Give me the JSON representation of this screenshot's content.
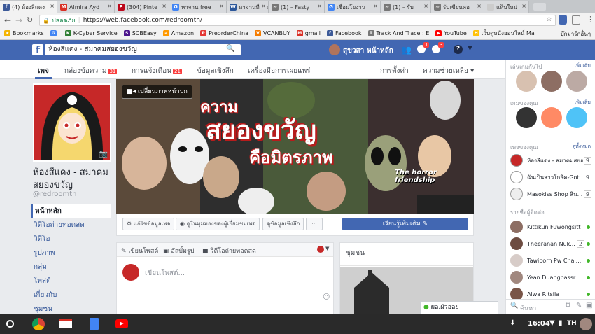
{
  "browser": {
    "tabs": [
      {
        "label": "(4) ห้องสีแดง",
        "icon": "f",
        "color": "#3b5998",
        "active": true
      },
      {
        "label": "Almira Ayd",
        "icon": "M",
        "color": "#d93025"
      },
      {
        "label": "(304) Pinte",
        "icon": "P",
        "color": "#bd081c"
      },
      {
        "label": "หาจาน free",
        "icon": "G",
        "color": "#4285f4"
      },
      {
        "label": "หาจานที่ควร",
        "icon": "W",
        "color": "#2b579a"
      },
      {
        "label": "(1) – Fasty",
        "icon": "~",
        "color": "#777"
      },
      {
        "label": "เชื่อมโยงาน",
        "icon": "G",
        "color": "#4285f4"
      },
      {
        "label": "(1) – รับ",
        "icon": "~",
        "color": "#777"
      },
      {
        "label": "รับเขียนคอ",
        "icon": "~",
        "color": "#777"
      },
      {
        "label": "แท็บใหม่",
        "icon": "",
        "color": "#ccc"
      }
    ],
    "secure_label": "ปลอดภัย",
    "url": "https://web.facebook.com/redroomth/",
    "bookmarks": [
      {
        "label": "Bookmarks",
        "icon": "★",
        "color": "#f4b400"
      },
      {
        "label": "",
        "icon": "G",
        "color": "#4285f4"
      },
      {
        "label": "K-Cyber Service",
        "icon": "K",
        "color": "#2e7d32"
      },
      {
        "label": "SCBEasy",
        "icon": "S",
        "color": "#4a148c"
      },
      {
        "label": "Amazon",
        "icon": "a",
        "color": "#ff9900"
      },
      {
        "label": "PreorderChina",
        "icon": "P",
        "color": "#e53935"
      },
      {
        "label": "VCANBUY",
        "icon": "V",
        "color": "#f57c00"
      },
      {
        "label": "gmail",
        "icon": "M",
        "color": "#d93025"
      },
      {
        "label": "Facebook",
        "icon": "f",
        "color": "#3b5998"
      },
      {
        "label": "Track And Trace : E",
        "icon": "T",
        "color": "#777"
      },
      {
        "label": "YouTube",
        "icon": "▶",
        "color": "#ff0000"
      },
      {
        "label": "เว็บดูหนังออนไลน์ Ma",
        "icon": "H",
        "color": "#ffc107"
      }
    ],
    "bookmarks_other": "บุ๊กมาร์กอื่นๆ"
  },
  "fb": {
    "search_value": "ห้องสีแดง - สมาคมสยองขวัญ",
    "user_name": "สุขวสา",
    "home_label": "หน้าหลัก",
    "msg_badge": "1",
    "notif_badge": "3"
  },
  "page_nav": {
    "page": "เพจ",
    "inbox": "กล่องข้อความ",
    "inbox_count": "31",
    "notifications": "การแจ้งเตือน",
    "notif_count": "21",
    "insights": "ข้อมูลเชิงลึก",
    "publishing": "เครื่องมือการเผยแพร่",
    "settings": "การตั้งค่า",
    "help": "ความช่วยเหลือ"
  },
  "page": {
    "name": "ห้องสีแดง - สมาคมสยองขวัญ",
    "name_line1": "ห้องสีแดง - สมาคม",
    "name_line2": "สยองขวัญ",
    "username": "@redroomth",
    "cover_button": "เปลี่ยนภาพหน้าปก",
    "cover_title_1": "ความ",
    "cover_title_2": "สยองขวัญ",
    "cover_title_3": "คือมิตรภาพ",
    "cover_subtitle": "The horror friendship",
    "side_nav": [
      "หน้าหลัก",
      "วิดีโอถ่ายทอดสด",
      "วิดีโอ",
      "รูปภาพ",
      "กลุ่ม",
      "โพสต์",
      "เกี่ยวกับ",
      "ชุมชน"
    ],
    "actions": {
      "edit": "แก้ไขข้อมูลเพจ",
      "view_as": "ดูในมุมมองของผู้เยี่ยมชมเพจ",
      "insights": "ดูข้อมูลเชิงลึก",
      "more": "···"
    },
    "learn_more": "เรียนรู้เพิ่มเติม",
    "composer": {
      "post": "เขียนโพสต์",
      "photo": "อัลบั้มรูป",
      "live": "วิดีโอถ่ายทอดสด",
      "placeholder": "เขียนโพสต์..."
    },
    "community_title": "ชุมชน"
  },
  "rail": {
    "play_title": "เล่นเกมกันไป",
    "play_more": "เพิ่มเติม",
    "games_title": "เกมของคุณ",
    "games_more": "เพิ่มเติม",
    "pages_title": "เพจของคุณ",
    "pages_all": "ดูทั้งหมด",
    "pages": [
      {
        "name": "ห้องสีแดง - สมาคมสยอ...",
        "count": "9"
      },
      {
        "name": "ฉันเป็นสาวโกธิค-Got...",
        "count": "9"
      },
      {
        "name": "Masokiss Shop สิน...",
        "count": "9"
      }
    ],
    "contacts_title": "รายชื่อผู้ติดต่อ",
    "contacts": [
      {
        "name": "Kittikun Fuwongsitt",
        "color": "#8d6e63"
      },
      {
        "name": "Theeranan Nuk...",
        "count": "2",
        "color": "#6d4c41"
      },
      {
        "name": "Tawiporn Pw Chai...",
        "color": "#d7ccc8"
      },
      {
        "name": "Yean Duangpassr...",
        "color": "#a1887f"
      },
      {
        "name": "Alwa Ritsila",
        "color": "#795548"
      }
    ],
    "search_placeholder": "ค้นหา",
    "chat_name": "ผอ.ผัวออย"
  },
  "taskbar": {
    "time": "16:04",
    "lang": "TH"
  }
}
